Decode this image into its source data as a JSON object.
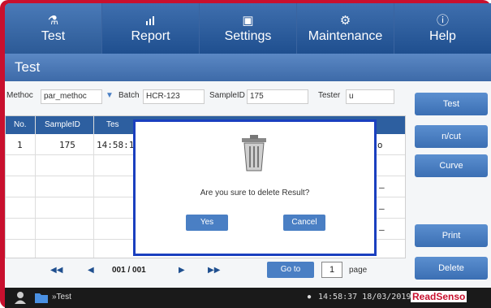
{
  "nav": {
    "items": [
      {
        "label": "Test",
        "icon": "flask-icon",
        "glyph": "⚗"
      },
      {
        "label": "Report",
        "icon": "chart-icon",
        "glyph": "📊"
      },
      {
        "label": "Settings",
        "icon": "settings-panel-icon",
        "glyph": "▣"
      },
      {
        "label": "Maintenance",
        "icon": "gear-icon",
        "glyph": "⚙"
      },
      {
        "label": "Help",
        "icon": "info-icon",
        "glyph": "ⓘ"
      }
    ]
  },
  "page_title": "Test",
  "filters": {
    "method_label": "Methoc",
    "method_value": "par_methoc",
    "batch_label": "Batch",
    "batch_value": "HCR-123",
    "sampleid_label": "SampleID",
    "sampleid_value": "175",
    "tester_label": "Tester",
    "tester_value": "u"
  },
  "table": {
    "headers": [
      "No.",
      "SampleID",
      "Tes"
    ],
    "rows": [
      {
        "no": "1",
        "sample_id": "175",
        "time": "14:58:1",
        "extra": "atio"
      }
    ],
    "dashes": [
      "–",
      "–",
      "–"
    ]
  },
  "pager": {
    "first": "◀◀",
    "prev": "◀",
    "page_info": "001 / 001",
    "next": "▶",
    "last": "▶▶",
    "goto_label": "Go to",
    "page_value": "1",
    "page_label": "page"
  },
  "side_buttons": [
    "Test",
    "n/cut",
    "Curve",
    "Print",
    "Delete"
  ],
  "status": {
    "breadcrumb": "»Test",
    "clock": "14:58:37 18/03/2019",
    "brand": "ReadSenso"
  },
  "modal": {
    "message": "Are you sure to delete Result?",
    "yes_label": "Yes",
    "cancel_label": "Cancel",
    "icon": "trash-icon"
  }
}
